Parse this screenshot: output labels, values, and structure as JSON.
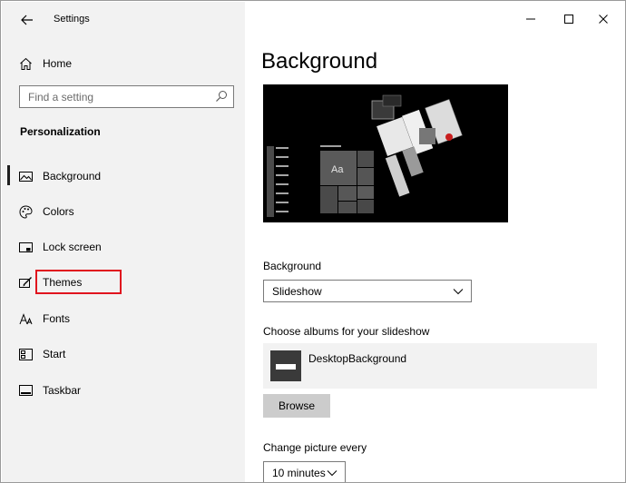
{
  "window": {
    "title": "Settings",
    "controls": {
      "minimize": "minimize",
      "maximize": "maximize",
      "close": "close"
    }
  },
  "sidebar": {
    "home_label": "Home",
    "search": {
      "placeholder": "Find a setting",
      "value": ""
    },
    "section_title": "Personalization",
    "items": [
      {
        "label": "Background",
        "icon": "picture-icon",
        "selected": true
      },
      {
        "label": "Colors",
        "icon": "palette-icon",
        "selected": false
      },
      {
        "label": "Lock screen",
        "icon": "lock-screen-icon",
        "selected": false
      },
      {
        "label": "Themes",
        "icon": "themes-icon",
        "selected": false,
        "highlighted": true
      },
      {
        "label": "Fonts",
        "icon": "fonts-icon",
        "selected": false
      },
      {
        "label": "Start",
        "icon": "start-icon",
        "selected": false
      },
      {
        "label": "Taskbar",
        "icon": "taskbar-icon",
        "selected": false
      }
    ]
  },
  "main": {
    "title": "Background",
    "preview": {
      "sample_text": "Aa"
    },
    "background_label": "Background",
    "background_value": "Slideshow",
    "albums_label": "Choose albums for your slideshow",
    "album_name": "DesktopBackground",
    "browse_label": "Browse",
    "interval_label": "Change picture every",
    "interval_value": "10 minutes"
  },
  "colors": {
    "sidebar_bg": "#f2f2f2",
    "highlight": "#e0141e",
    "button_bg": "#cccccc"
  }
}
